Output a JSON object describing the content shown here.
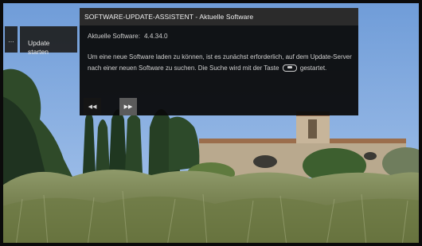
{
  "side_menu": {
    "more_label": "...",
    "update_label": "Update\nstarten"
  },
  "dialog": {
    "title": "SOFTWARE-UPDATE-ASSISTENT - Aktuelle Software",
    "version_label": "Aktuelle Software:",
    "version_value": "4.4.34.0",
    "text_part1": "Um eine neue Software laden zu können, ist es zunächst erforderlich, auf dem Update-Server nach einer neuen Software zu suchen. Die Suche wird mit der Taste",
    "text_part2": "gestartet."
  },
  "nav": {
    "prev": "◀◀",
    "next": "▶▶"
  }
}
